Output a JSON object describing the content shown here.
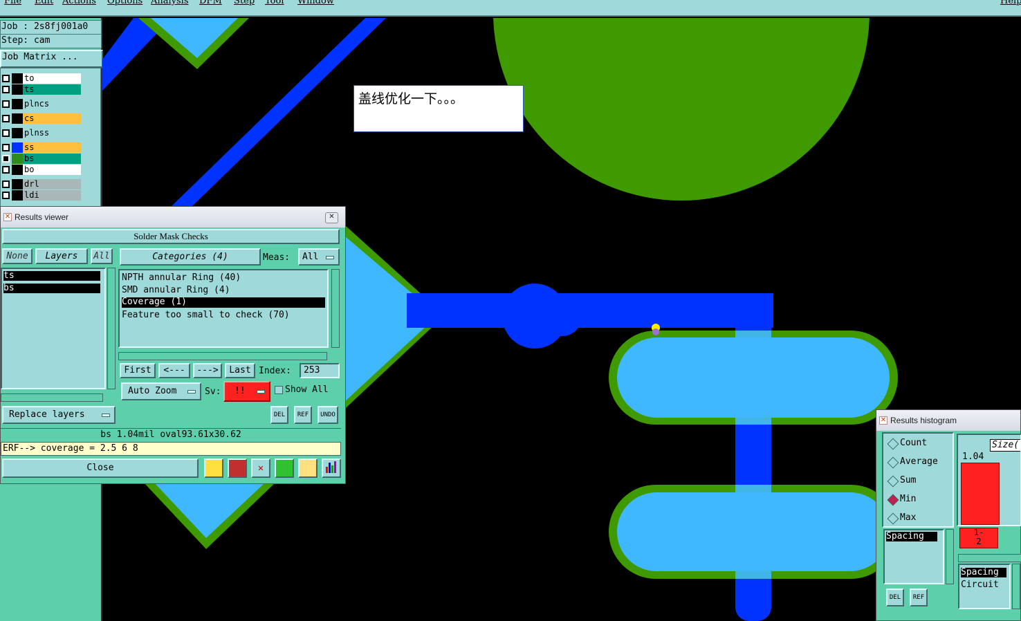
{
  "menu": [
    "File",
    "Edit",
    "Actions",
    "Options",
    "Analysis",
    "DFM",
    "Step",
    "Tool",
    "Window",
    "Help"
  ],
  "left_panel": {
    "job_label": "Job : 2s8fj001a0",
    "step_label": "Step: cam",
    "job_matrix_button": "Job Matrix ...",
    "layers": [
      {
        "name": "to",
        "bg": "#ffffff",
        "swatch": "#000000"
      },
      {
        "name": "ts",
        "bg": "#00a080",
        "swatch": "#000000"
      },
      {
        "name": "plncs",
        "bg": "#9fd9d9",
        "swatch": "#000000"
      },
      {
        "name": "cs",
        "bg": "#ffc040",
        "swatch": "#000000"
      },
      {
        "name": "plnss",
        "bg": "#9fd9d9",
        "swatch": "#000000"
      },
      {
        "name": "ss",
        "bg": "#ffc040",
        "swatch": "#0033ff"
      },
      {
        "name": "bs",
        "bg": "#00a080",
        "swatch": "#2e8b20"
      },
      {
        "name": "bo",
        "bg": "#ffffff",
        "swatch": "#000000"
      },
      {
        "name": "drl",
        "bg": "#a8b8b8",
        "swatch": "#000000"
      },
      {
        "name": "ldi",
        "bg": "#a8b8b8",
        "swatch": "#000000"
      }
    ]
  },
  "note": {
    "text": "盖线优化一下。。。"
  },
  "results_viewer": {
    "title": "Results viewer",
    "header": "Solder Mask Checks",
    "filter_none": "None",
    "filter_layers": "Layers",
    "filter_all": "All",
    "layer_items": [
      "ts",
      "bs"
    ],
    "categories_label": "Categories (4)",
    "meas_label": "Meas:",
    "meas_value": "All",
    "categories": [
      {
        "text": "NPTH annular Ring (40)",
        "selected": false
      },
      {
        "text": "SMD annular Ring (4)",
        "selected": false
      },
      {
        "text": "Coverage (1)",
        "selected": true
      },
      {
        "text": "Feature too small to check (70)",
        "selected": false
      }
    ],
    "nav_first": "First",
    "nav_prev": "<---",
    "nav_next": "--->",
    "nav_last": "Last",
    "index_label": "Index:",
    "index_value": "253",
    "auto_zoom": "Auto Zoom",
    "sv_label": "Sv:",
    "sv_value": "!!",
    "show_all": "Show All",
    "replace_layers": "Replace layers",
    "del_label": "DEL",
    "ref_label": "REF",
    "undo_label": "UNDO",
    "status_line": "bs 1.04mil  oval93.61x30.62",
    "erf_line": "ERF--> coverage = 2.5 6 8",
    "close_button": "Close"
  },
  "results_histogram": {
    "title": "Results histogram",
    "stats": [
      {
        "label": "Count",
        "selected": false
      },
      {
        "label": "Average",
        "selected": false
      },
      {
        "label": "Sum",
        "selected": false
      },
      {
        "label": "Min",
        "selected": true
      },
      {
        "label": "Max",
        "selected": false
      }
    ],
    "size_label": "Size(",
    "bar_value": "1.04",
    "bar_range": "1-\n2",
    "list_item": "Spacing",
    "right_list": [
      "Spacing",
      "Circuit"
    ],
    "del_label": "DEL",
    "ref_label": "REF"
  },
  "colors": {
    "panel": "#5dcfaa",
    "widget": "#9fd9d9",
    "copper_blue": "#0033ff",
    "mask_green": "#3f9a00",
    "pad_light": "#40b8ff",
    "alert_red": "#ff2020"
  }
}
